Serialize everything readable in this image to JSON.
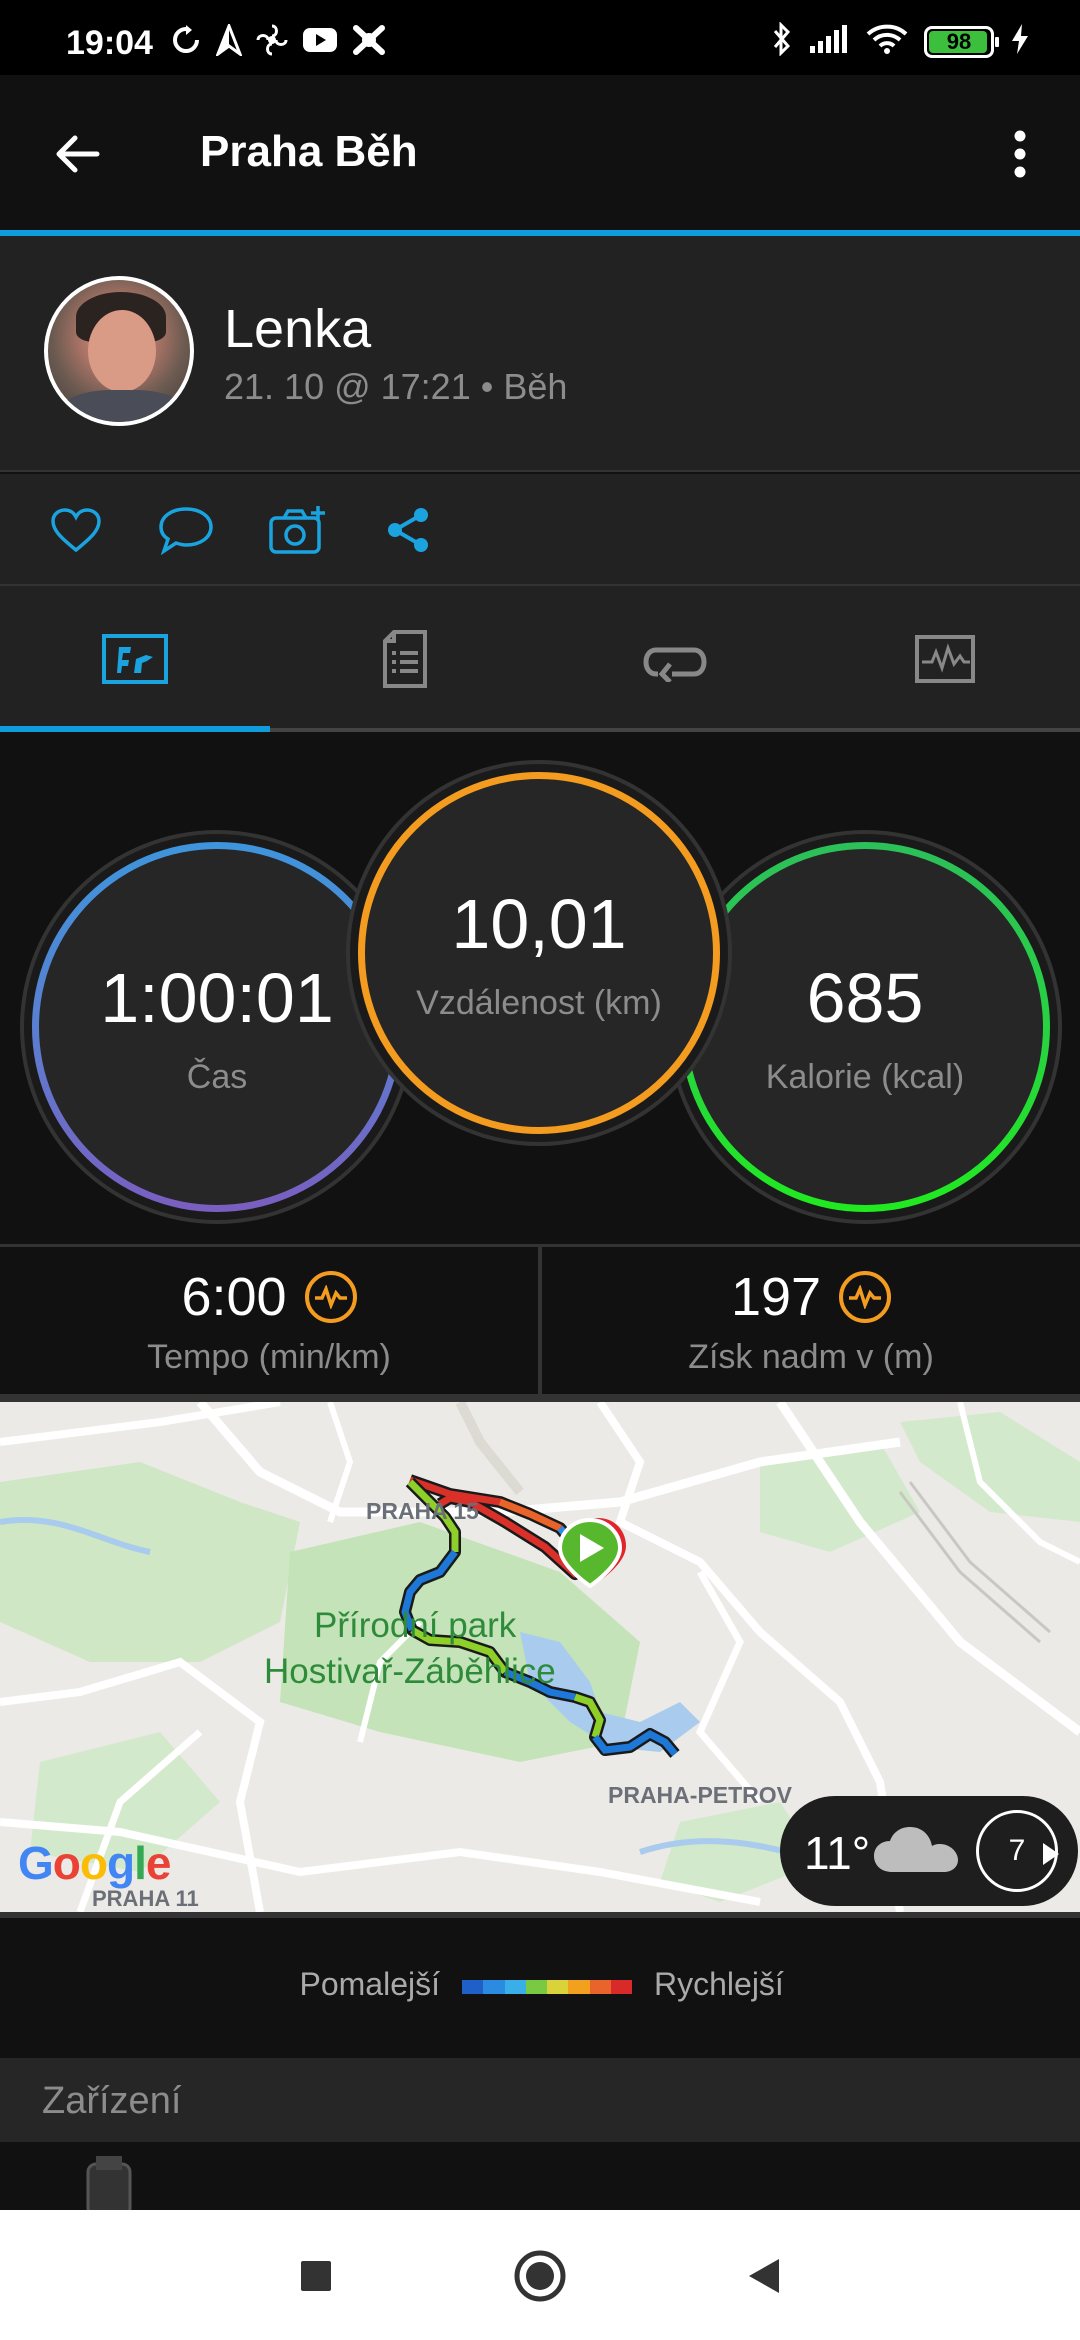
{
  "status_bar": {
    "time": "19:04",
    "battery": "98",
    "left_icons": [
      "sync-icon",
      "navigation-icon",
      "fan-icon",
      "youtube-icon",
      "game-icon"
    ],
    "right_icons": [
      "bluetooth-icon",
      "signal-icon",
      "wifi-icon",
      "battery-icon",
      "charging-icon"
    ]
  },
  "app_bar": {
    "title": "Praha Běh",
    "back_icon": "arrow-left-icon",
    "menu_icon": "more-vertical-icon"
  },
  "profile": {
    "name": "Lenka",
    "subtitle": "21. 10 @ 17:21 • Běh"
  },
  "social": {
    "icons": [
      "heart-icon",
      "comment-icon",
      "camera-add-icon",
      "share-icon"
    ],
    "accent": "#1ba3e0"
  },
  "tabs": {
    "items": [
      "overview-icon",
      "details-icon",
      "laps-icon",
      "charts-icon"
    ],
    "selected": 0
  },
  "stats": {
    "time": {
      "value": "1:00:01",
      "label": "Čas"
    },
    "distance": {
      "value": "10,01",
      "label": "Vzdálenost (km)"
    },
    "calories": {
      "value": "685",
      "label": "Kalorie (kcal)"
    }
  },
  "metrics": {
    "tempo": {
      "value": "6:00",
      "label": "Tempo (min/km)"
    },
    "elevation": {
      "value": "197",
      "label": "Získ nadm v (m)"
    }
  },
  "map": {
    "labels": {
      "praha15": "PRAHA 15",
      "park_line1": "Přírodní park",
      "park_line2": "Hostivař-Záběhlice",
      "petrovice": "PRAHA-PETROV",
      "praha11": "PRAHA 11"
    },
    "google": "Google",
    "weather_temp": "11°",
    "wind": "7"
  },
  "legend": {
    "slower": "Pomalejší",
    "faster": "Rychlejší",
    "colors": [
      "#1e60c8",
      "#2b8be0",
      "#3aaee8",
      "#7ac943",
      "#d9d23a",
      "#f2a11f",
      "#e8642a",
      "#d92a2a"
    ]
  },
  "devices": {
    "heading": "Zařízení"
  },
  "nav_bar": {
    "icons": [
      "recent-apps-icon",
      "home-icon",
      "back-icon"
    ]
  }
}
